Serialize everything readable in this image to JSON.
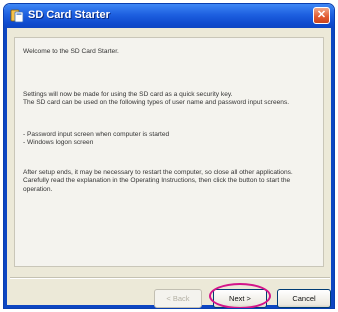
{
  "window": {
    "title": "SD Card Starter",
    "close_symbol": "✕",
    "app_icon": "sd-card-icon"
  },
  "content": {
    "welcome": "Welcome to the SD Card Starter.",
    "intro": "Settings will now be made for using the SD card as a quick security key.\nThe SD card can be used on the following types of user name and password input screens.",
    "list": "- Password input screen when computer is started\n- Windows logon screen",
    "outro": "After setup ends, it may be necessary to restart the computer, so close all other applications.\nCarefully read the explanation in the Operating Instructions, then click the button to start the operation."
  },
  "buttons": {
    "back": "< Back",
    "next": "Next >",
    "cancel": "Cancel"
  },
  "colors": {
    "highlight": "#d4148a",
    "titlebar": "#1d5fe0"
  }
}
